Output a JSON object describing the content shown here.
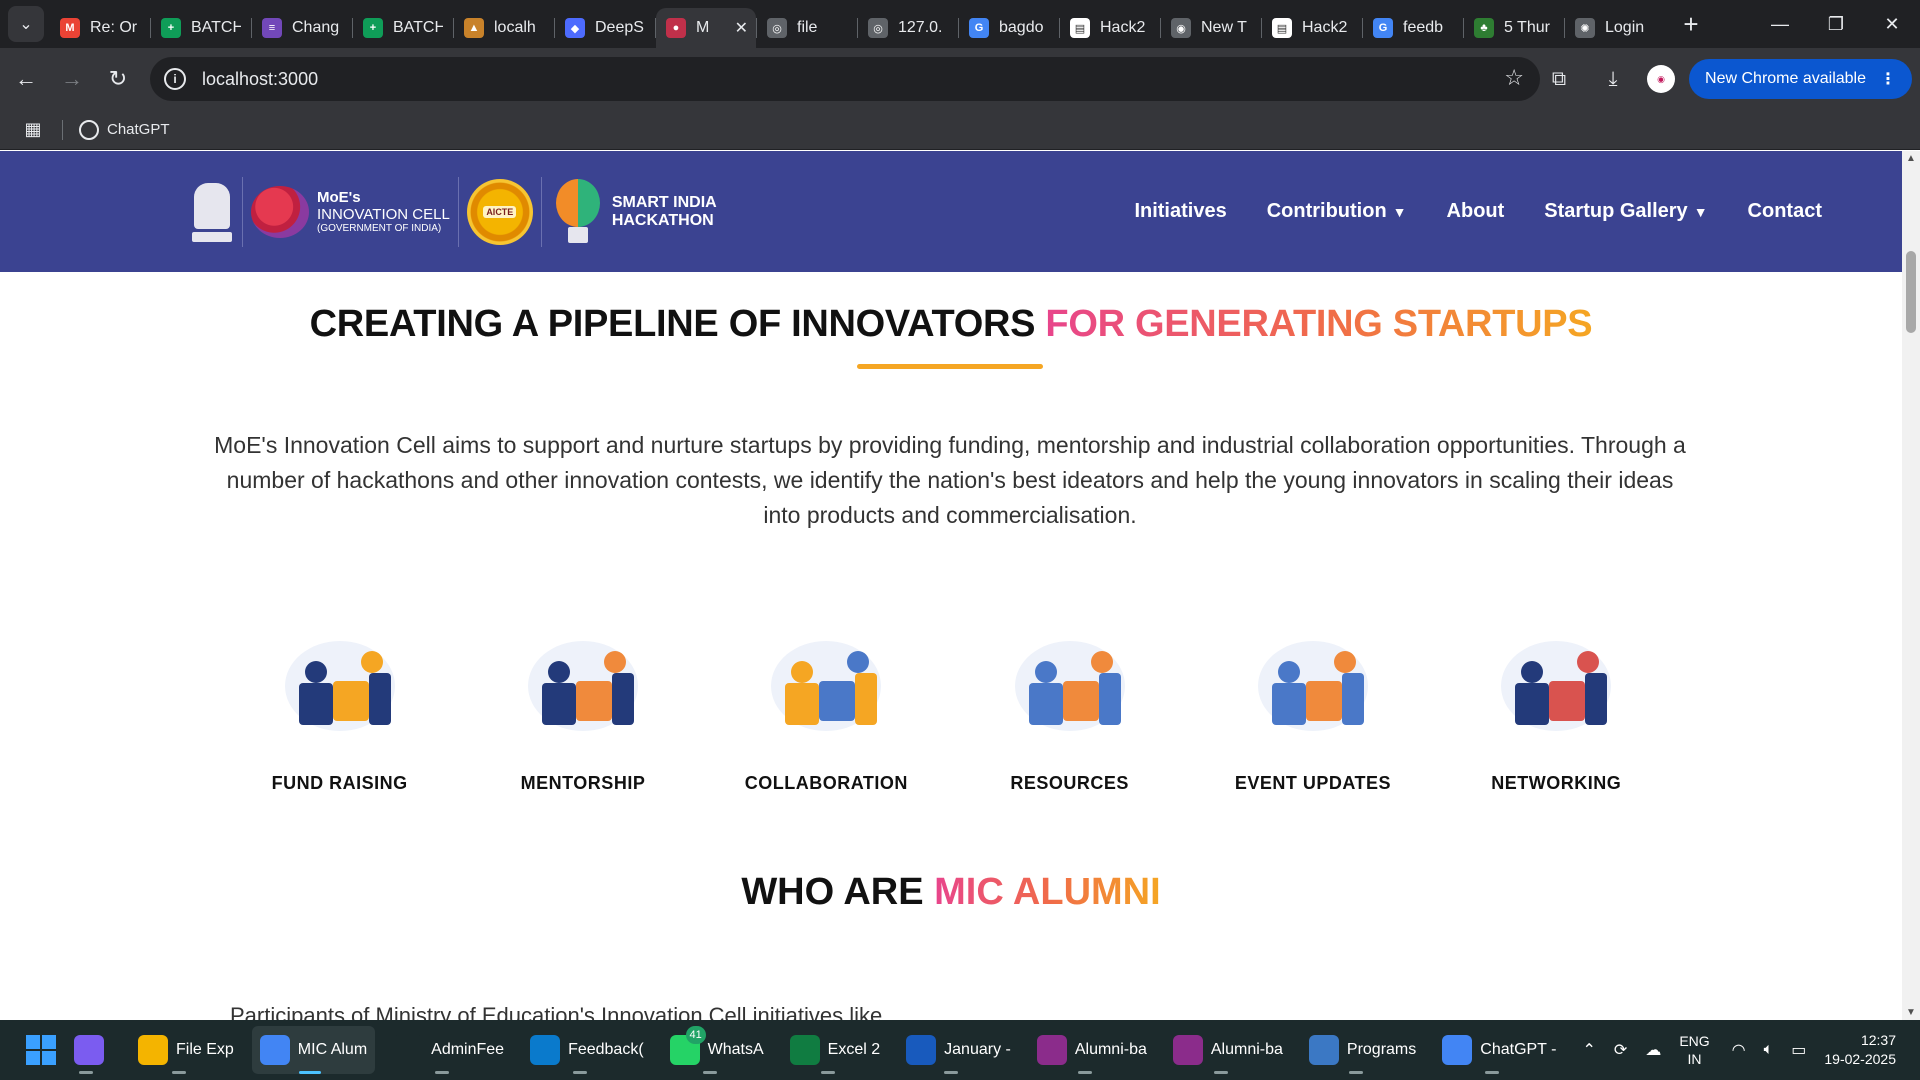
{
  "browser": {
    "tabs": [
      {
        "label": "Re: Or",
        "icon": "gmail-icon",
        "color": "#ea4335",
        "glyph": "M"
      },
      {
        "label": "BATCH",
        "icon": "sheets-icon",
        "color": "#0f9d58",
        "glyph": "+"
      },
      {
        "label": "Chang",
        "icon": "forms-icon",
        "color": "#7248b9",
        "glyph": "≡"
      },
      {
        "label": "BATCH",
        "icon": "sheets-icon",
        "color": "#0f9d58",
        "glyph": "+"
      },
      {
        "label": "localh",
        "icon": "app-icon",
        "color": "#c8822a",
        "glyph": "▲"
      },
      {
        "label": "DeepS",
        "icon": "deepseek-icon",
        "color": "#4d6bfe",
        "glyph": "◆"
      },
      {
        "label": "M",
        "icon": "mic-icon",
        "color": "#c0304a",
        "glyph": "●",
        "active": true
      },
      {
        "label": "file",
        "icon": "globe-icon",
        "color": "#5f6368",
        "glyph": "◎"
      },
      {
        "label": "127.0.",
        "icon": "globe-icon",
        "color": "#5f6368",
        "glyph": "◎"
      },
      {
        "label": "bagdo",
        "icon": "google-icon",
        "color": "#4285f4",
        "glyph": "G"
      },
      {
        "label": "Hack2",
        "icon": "doc-icon",
        "color": "#ffffff",
        "glyph": "▤"
      },
      {
        "label": "New T",
        "icon": "chrome-icon",
        "color": "#5f6368",
        "glyph": "◉"
      },
      {
        "label": "Hack2",
        "icon": "doc-icon",
        "color": "#ffffff",
        "glyph": "▤"
      },
      {
        "label": "feedb",
        "icon": "google-icon",
        "color": "#4285f4",
        "glyph": "G"
      },
      {
        "label": "5 Thur",
        "icon": "leaf-icon",
        "color": "#2e7d32",
        "glyph": "♣"
      },
      {
        "label": "Login",
        "icon": "openai-icon",
        "color": "#5f6368",
        "glyph": "✺"
      }
    ],
    "url": "localhost:3000",
    "update_label": "New Chrome available",
    "bookmark": "ChatGPT"
  },
  "site": {
    "nav": {
      "initiatives": "Initiatives",
      "contribution": "Contribution",
      "about": "About",
      "startup_gallery": "Startup Gallery",
      "contact": "Contact"
    },
    "logos": {
      "mic_line1": "MoE's",
      "mic_line2": "INNOVATION CELL",
      "mic_line3": "(GOVERNMENT OF INDIA)",
      "aicte": "AICTE",
      "sih_line1": "SMART INDIA",
      "sih_line2": "HACKATHON"
    },
    "hero": {
      "title_plain": "CREATING A PIPELINE OF INNOVATORS ",
      "title_accent": "FOR GENERATING STARTUPS",
      "description": "MoE's Innovation Cell aims to support and nurture startups by providing funding, mentorship and industrial collaboration opportunities. Through a number of hackathons and other innovation contests, we identify the nation's best ideators and help the young innovators in scaling their ideas into products and commercialisation."
    },
    "features": [
      {
        "label": "FUND RAISING",
        "icon": "fund-raising-illustration"
      },
      {
        "label": "MENTORSHIP",
        "icon": "mentorship-illustration"
      },
      {
        "label": "COLLABORATION",
        "icon": "collaboration-illustration"
      },
      {
        "label": "RESOURCES",
        "icon": "resources-illustration"
      },
      {
        "label": "EVENT UPDATES",
        "icon": "event-updates-illustration"
      },
      {
        "label": "NETWORKING",
        "icon": "networking-illustration"
      }
    ],
    "alumni": {
      "title_plain": "WHO ARE ",
      "title_accent": "MIC ALUMNI",
      "intro": "Participants of Ministry of Education's Innovation Cell initiatives like"
    }
  },
  "taskbar": {
    "apps": [
      {
        "label": "",
        "icon": "copilot-icon",
        "color": "#7b5cf0"
      },
      {
        "label": "File Exp",
        "icon": "file-explorer-icon",
        "color": "#f4b400"
      },
      {
        "label": "MIC Alum",
        "icon": "chrome-icon",
        "color": "#4285f4",
        "active": true
      },
      {
        "label": "AdminFee",
        "icon": "app-icon",
        "color": "#1c2a2c"
      },
      {
        "label": "Feedback(",
        "icon": "vscode-icon",
        "color": "#0a7acc"
      },
      {
        "label": "WhatsA",
        "icon": "whatsapp-icon",
        "color": "#25d366",
        "badge": "41"
      },
      {
        "label": "Excel 2",
        "icon": "excel-icon",
        "color": "#107c41"
      },
      {
        "label": "January - ",
        "icon": "word-icon",
        "color": "#185abd"
      },
      {
        "label": "Alumni-ba",
        "icon": "winrar-icon",
        "color": "#8b2c8b"
      },
      {
        "label": "Alumni-ba",
        "icon": "winrar-icon",
        "color": "#8b2c8b"
      },
      {
        "label": "Programs",
        "icon": "control-panel-icon",
        "color": "#3b78c4"
      },
      {
        "label": "ChatGPT - ",
        "icon": "chrome-icon",
        "color": "#4285f4"
      }
    ],
    "lang_1": "ENG",
    "lang_2": "IN",
    "time": "12:37",
    "date": "19-02-2025"
  }
}
